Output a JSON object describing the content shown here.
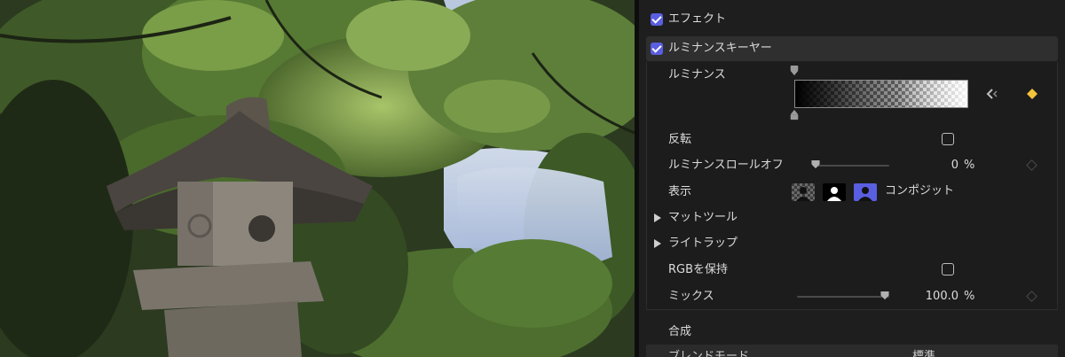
{
  "inspector": {
    "effects_section": {
      "label": "エフェクト",
      "checked": true
    },
    "luma_keyer": {
      "label": "ルミナンスキーヤー",
      "checked": true
    },
    "luminance": {
      "label": "ルミナンス"
    },
    "invert": {
      "label": "反転",
      "checked": false
    },
    "luma_rolloff": {
      "label": "ルミナンスロールオフ",
      "value": "0",
      "unit": "%",
      "fraction": 0.0
    },
    "view": {
      "label": "表示",
      "mode_label": "コンポジット",
      "selected": "composite"
    },
    "matte_tools": {
      "label": "マットツール",
      "expanded": false
    },
    "light_wrap": {
      "label": "ライトラップ",
      "expanded": false
    },
    "preserve_rgb": {
      "label": "RGBを保持",
      "checked": false
    },
    "mix": {
      "label": "ミックス",
      "value": "100.0",
      "unit": "%",
      "fraction": 1.0
    },
    "compositing": {
      "label": "合成"
    },
    "blend_mode": {
      "label": "ブレンドモード",
      "value": "標準"
    }
  },
  "colors": {
    "accent": "#5a5ee0",
    "keyframe_active": "#f3c33c",
    "panel_bg": "#1e1e1e",
    "section_bg": "#2f2f2f"
  },
  "icons": {
    "checkbox": "checkmark",
    "keyframe_nav": "chevron-left-icon",
    "keyframe": "diamond-icon",
    "disclosure": "triangle-right-icon",
    "view_alpha": "person-silhouette-checker-icon",
    "view_matte": "person-silhouette-white-icon",
    "view_composite": "person-silhouette-blue-icon"
  }
}
